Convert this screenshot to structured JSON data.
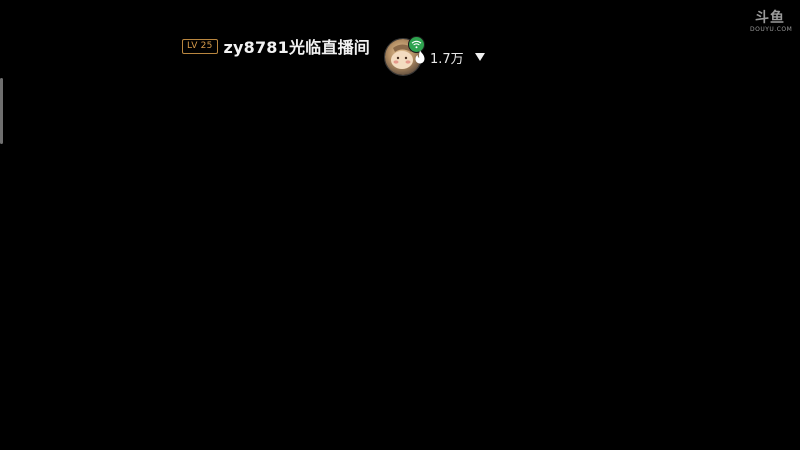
{
  "room": {
    "level_badge": "LV 25",
    "title": "zy8781光临直播间",
    "heat_count": "1.7万"
  },
  "watermark": {
    "logo": "斗鱼",
    "domain": "DOUYU.COM"
  },
  "colors": {
    "background": "#000000",
    "badge": "#d59a4a",
    "live_indicator": "#2ea34f",
    "title_text": "#f2f2f2"
  },
  "icons": {
    "avatar": "streamer-avatar",
    "live": "wifi-icon",
    "heat": "flame-icon",
    "menu": "chevron-down-icon"
  }
}
